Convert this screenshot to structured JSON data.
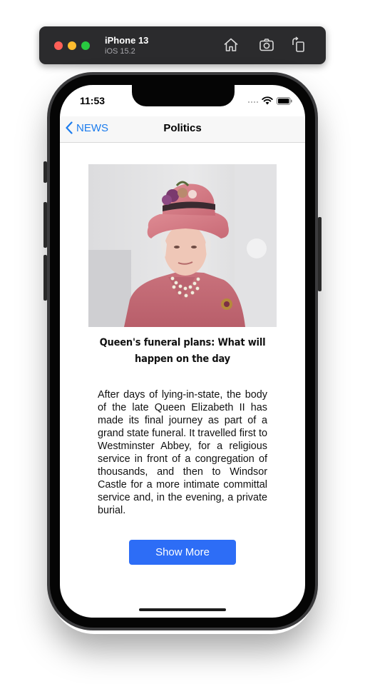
{
  "simulator": {
    "device_name": "iPhone 13",
    "os_version": "iOS 15.2",
    "toolbar_icons": [
      "home-icon",
      "screenshot-icon",
      "rotate-icon"
    ]
  },
  "status_bar": {
    "time": "11:53",
    "icons": [
      "cellular-dots-icon",
      "wifi-icon",
      "battery-icon"
    ]
  },
  "navbar": {
    "back_label": "NEWS",
    "back_icon": "chevron-left-icon",
    "title": "Politics"
  },
  "article": {
    "image_subject": "portrait of the late Queen Elizabeth II in a pink hat and coat",
    "headline": "Queen's funeral plans: What will happen on the day",
    "body": "After days of lying-in-state, the body of the late Queen Elizabeth II has made its final journey as part of a grand state funeral. It travelled first to Westminster Abbey, for a religious service in front of a congregation of thousands, and then to Windsor Castle for a more intimate committal service and, in the evening, a private burial.",
    "button_label": "Show More"
  },
  "colors": {
    "accent": "#1c7ced",
    "button": "#2d6df6",
    "navbar_bg": "#f7f7f7",
    "toolbar_bg": "#2b2b2d"
  }
}
